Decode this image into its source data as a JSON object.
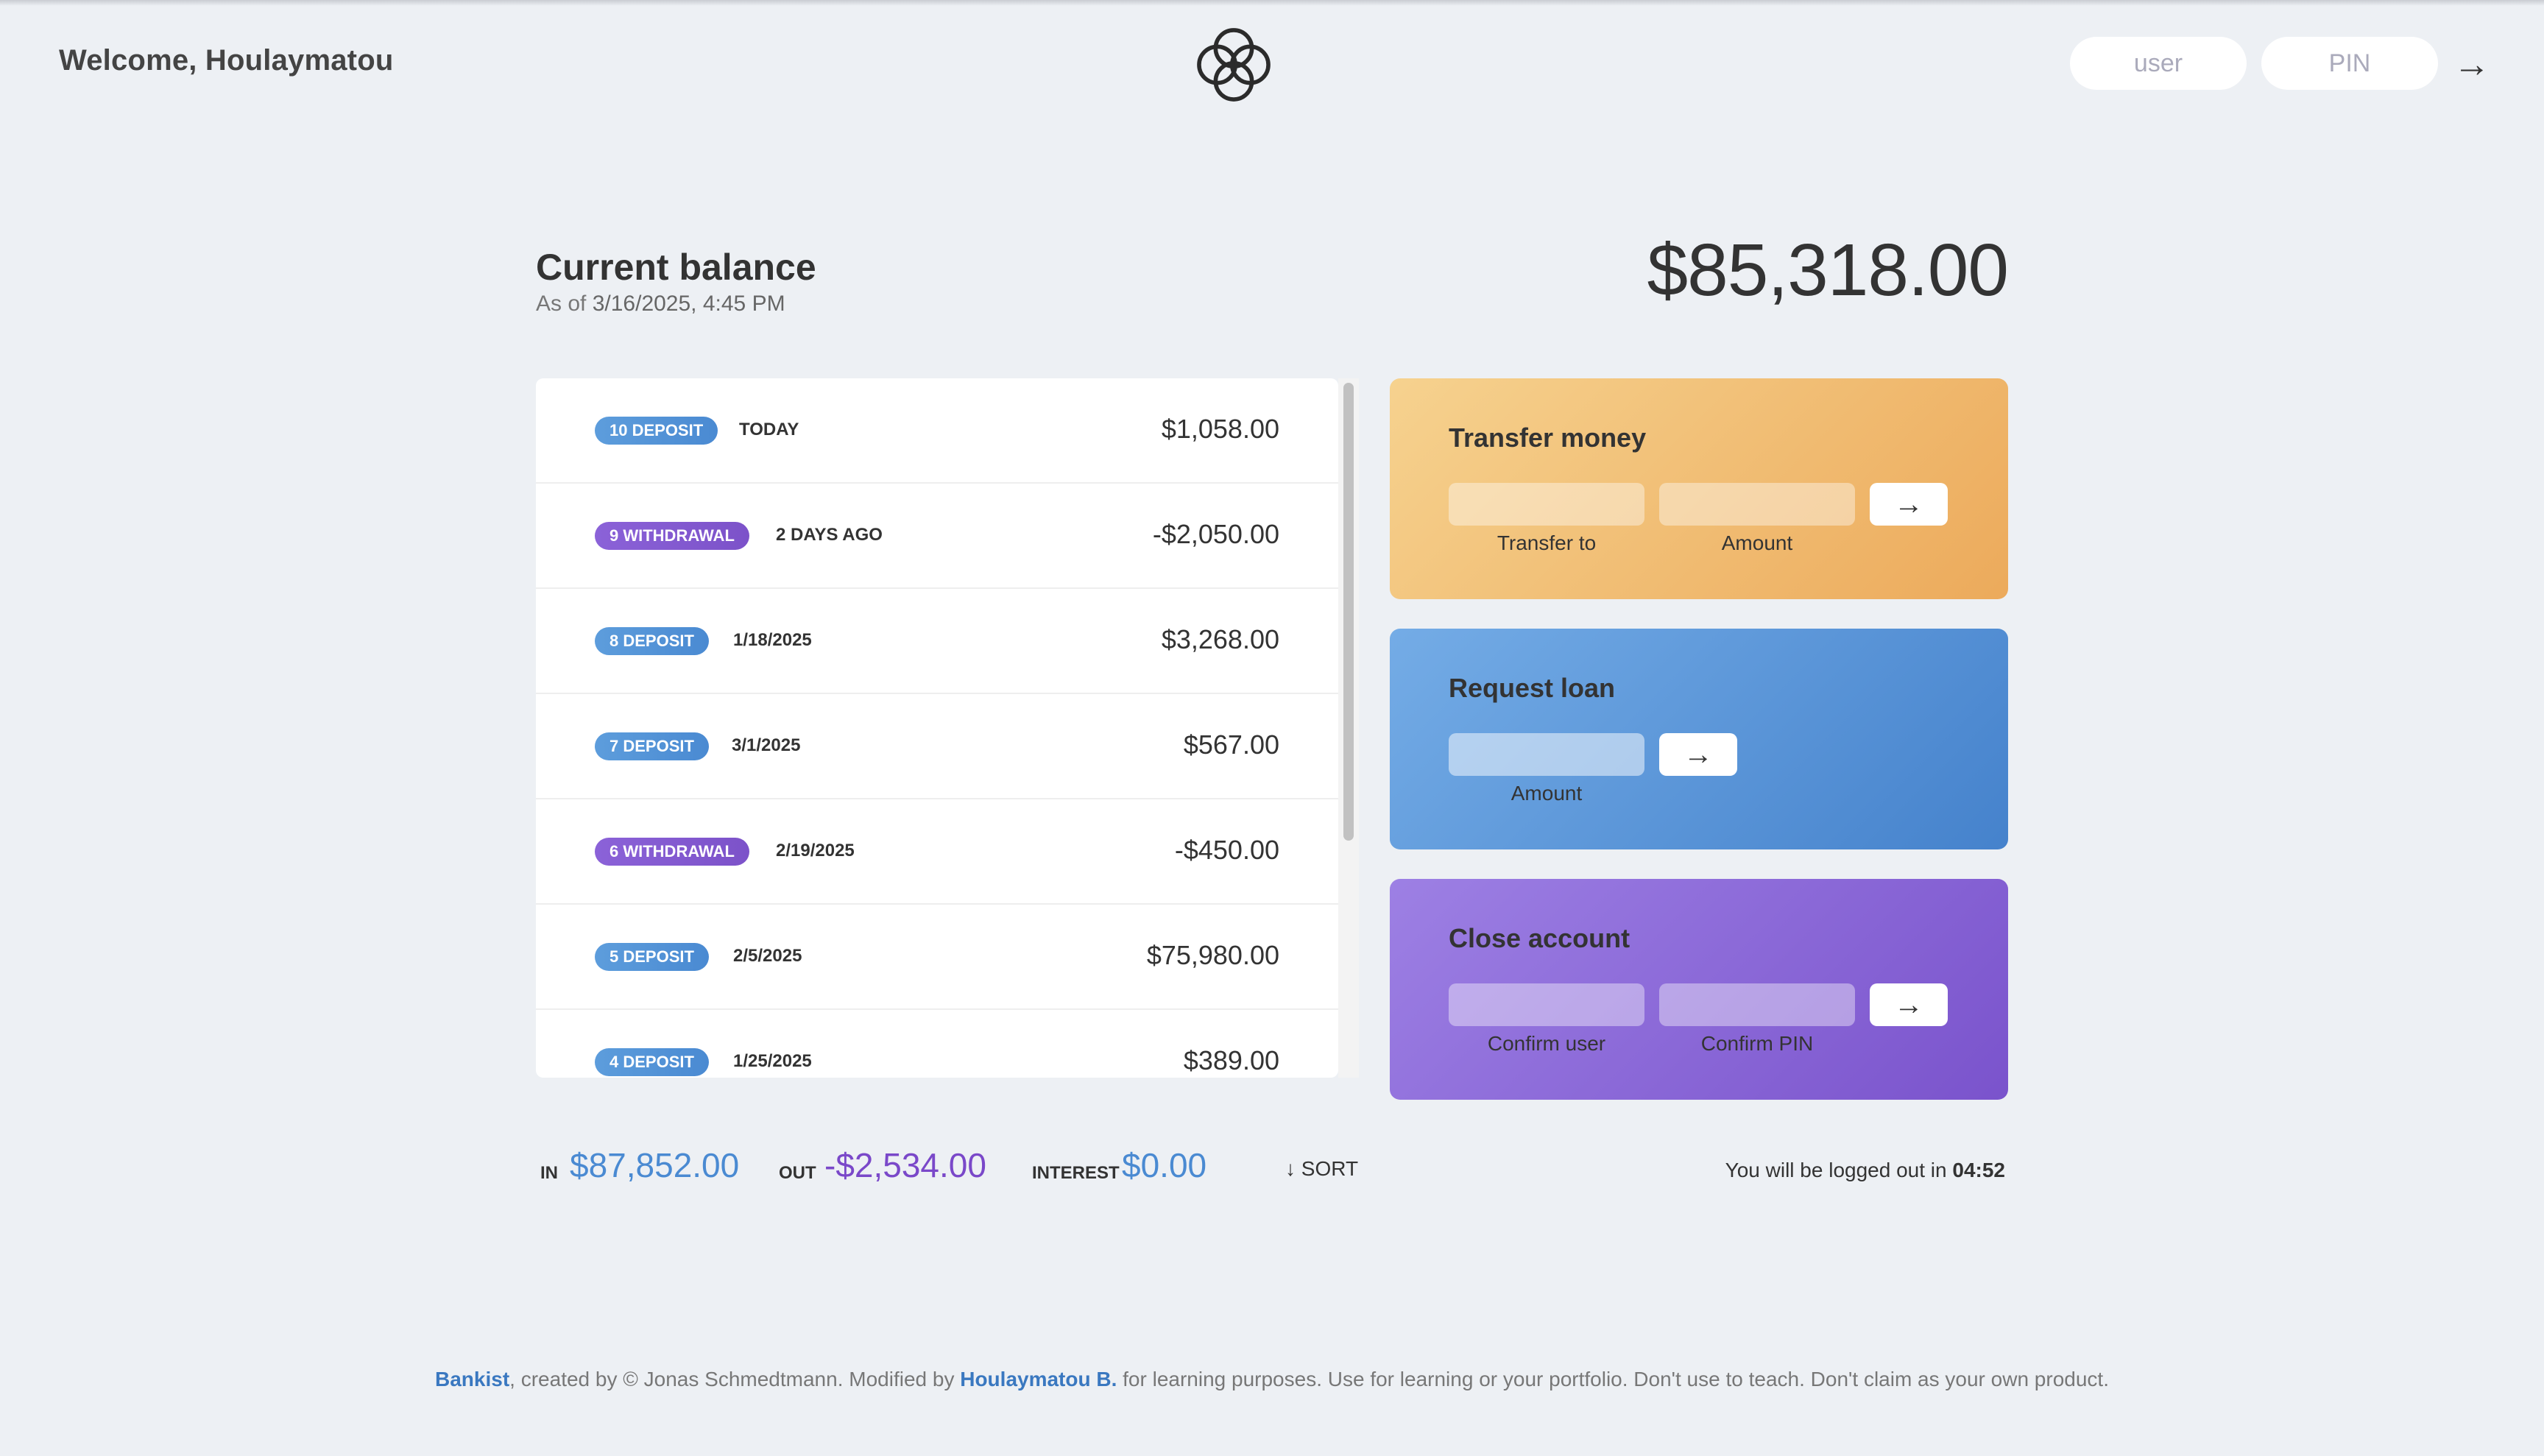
{
  "nav": {
    "welcome": "Welcome, Houlaymatou",
    "user_placeholder": "user",
    "pin_placeholder": "PIN",
    "login_arrow": "→"
  },
  "balance": {
    "label": "Current balance",
    "as_of_prefix": "As of",
    "date": "3/16/2025, 4:45 PM",
    "value": "$85,318.00"
  },
  "movements": [
    {
      "type": "deposit",
      "type_label": "10 deposit",
      "date": "today",
      "value": "$1,058.00"
    },
    {
      "type": "withdrawal",
      "type_label": "9 withdrawal",
      "date": "2 days ago",
      "value": "-$2,050.00"
    },
    {
      "type": "deposit",
      "type_label": "8 deposit",
      "date": "1/18/2025",
      "value": "$3,268.00"
    },
    {
      "type": "deposit",
      "type_label": "7 deposit",
      "date": "3/1/2025",
      "value": "$567.00"
    },
    {
      "type": "withdrawal",
      "type_label": "6 withdrawal",
      "date": "2/19/2025",
      "value": "-$450.00"
    },
    {
      "type": "deposit",
      "type_label": "5 deposit",
      "date": "2/5/2025",
      "value": "$75,980.00"
    },
    {
      "type": "deposit",
      "type_label": "4 deposit",
      "date": "1/25/2025",
      "value": "$389.00"
    }
  ],
  "operations": {
    "transfer": {
      "title": "Transfer money",
      "label_to": "Transfer to",
      "label_amount": "Amount",
      "arrow": "→"
    },
    "loan": {
      "title": "Request loan",
      "label_amount": "Amount",
      "arrow": "→"
    },
    "close": {
      "title": "Close account",
      "label_user": "Confirm user",
      "label_pin": "Confirm PIN",
      "arrow": "→"
    }
  },
  "summary": {
    "in_label": "In",
    "in_value": "$87,852.00",
    "out_label": "Out",
    "out_value": "-$2,534.00",
    "interest_label": "Interest",
    "interest_value": "$0.00",
    "sort_label": "↓ SORT"
  },
  "logout": {
    "prefix": "You will be logged out in",
    "timer": "04:52"
  },
  "footer": {
    "brand": "Bankist",
    "text1": ", created by © Jonas Schmedtmann. Modified by ",
    "author": "Houlaymatou B.",
    "text2": " for learning purposes. Use for learning or your portfolio. Don't use to teach. Don't claim as your own product."
  },
  "colors": {
    "deposit": "#4a8ad2",
    "withdrawal": "#7c52c9",
    "transfer_card": "#ecaa5b",
    "loan_card": "#4582cc",
    "close_card": "#7a53cc"
  }
}
